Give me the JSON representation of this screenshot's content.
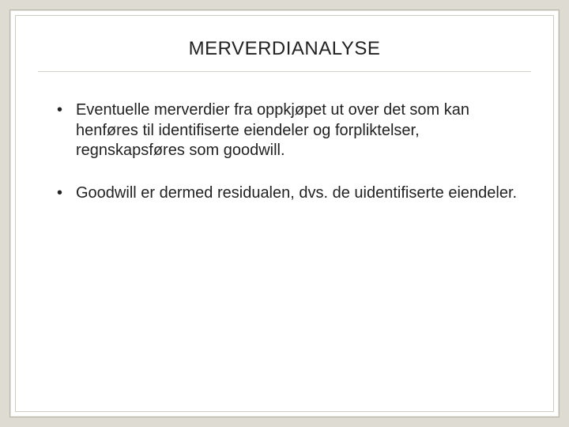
{
  "slide": {
    "title": "MERVERDIANALYSE",
    "bullets": [
      "Eventuelle merverdier fra oppkjøpet ut over det som kan henføres til identifiserte eiendeler og forpliktelser, regnskapsføres som goodwill.",
      "Goodwill er dermed residualen, dvs. de uidentifiserte eiendeler."
    ]
  }
}
